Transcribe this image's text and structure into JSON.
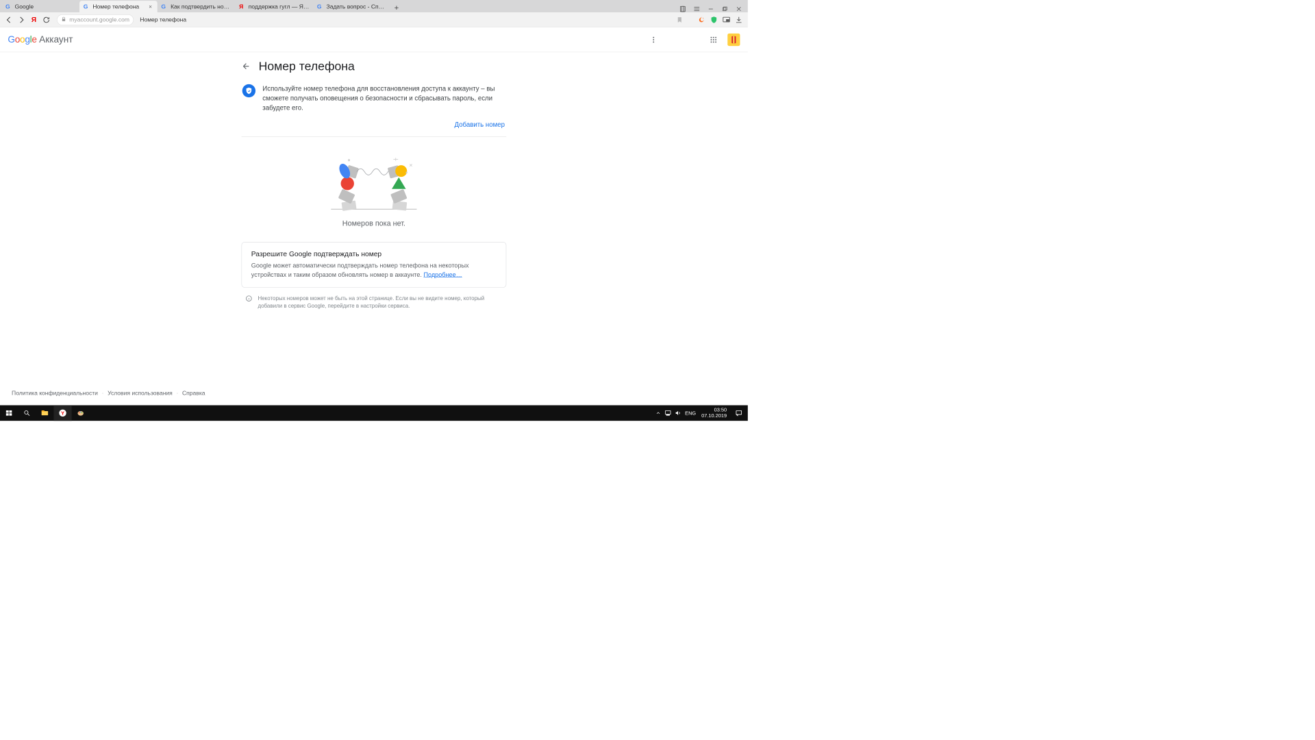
{
  "browser": {
    "tabs": [
      {
        "title": "Google",
        "favicon": "google"
      },
      {
        "title": "Номер телефона",
        "favicon": "google",
        "active": true
      },
      {
        "title": "Как подтвердить номер те",
        "favicon": "google"
      },
      {
        "title": "поддержка гугл — Яндекс",
        "favicon": "yandex"
      },
      {
        "title": "Задать вопрос - Справка -",
        "favicon": "google"
      }
    ],
    "url_host": "myaccount.google.com",
    "url_crumb": "Номер телефона"
  },
  "header": {
    "logo_parts": [
      "G",
      "o",
      "o",
      "g",
      "l",
      "e"
    ],
    "account_label": "Аккаунт"
  },
  "page": {
    "title": "Номер телефона",
    "info_text": "Используйте номер телефона для восстановления доступа к аккаунту – вы сможете получать оповещения о безопасности и сбрасывать пароль, если забудете его.",
    "add_number_label": "Добавить номер",
    "empty_message": "Номеров пока нет.",
    "verify_box": {
      "title": "Разрешите Google подтверждать номер",
      "body": "Google может автоматически подтверждать номер телефона на некоторых устройствах и таким образом обновлять номер в аккаунте. ",
      "link": "Подробнее…"
    },
    "note": "Некоторых номеров может не быть на этой странице. Если вы не видите номер, который добавили в сервис Google, перейдите в настройки сервиса."
  },
  "footer": {
    "privacy": "Политика конфиденциальности",
    "terms": "Условия использования",
    "help": "Справка"
  },
  "taskbar": {
    "lang": "ENG",
    "time": "03:50",
    "date": "07.10.2019"
  }
}
